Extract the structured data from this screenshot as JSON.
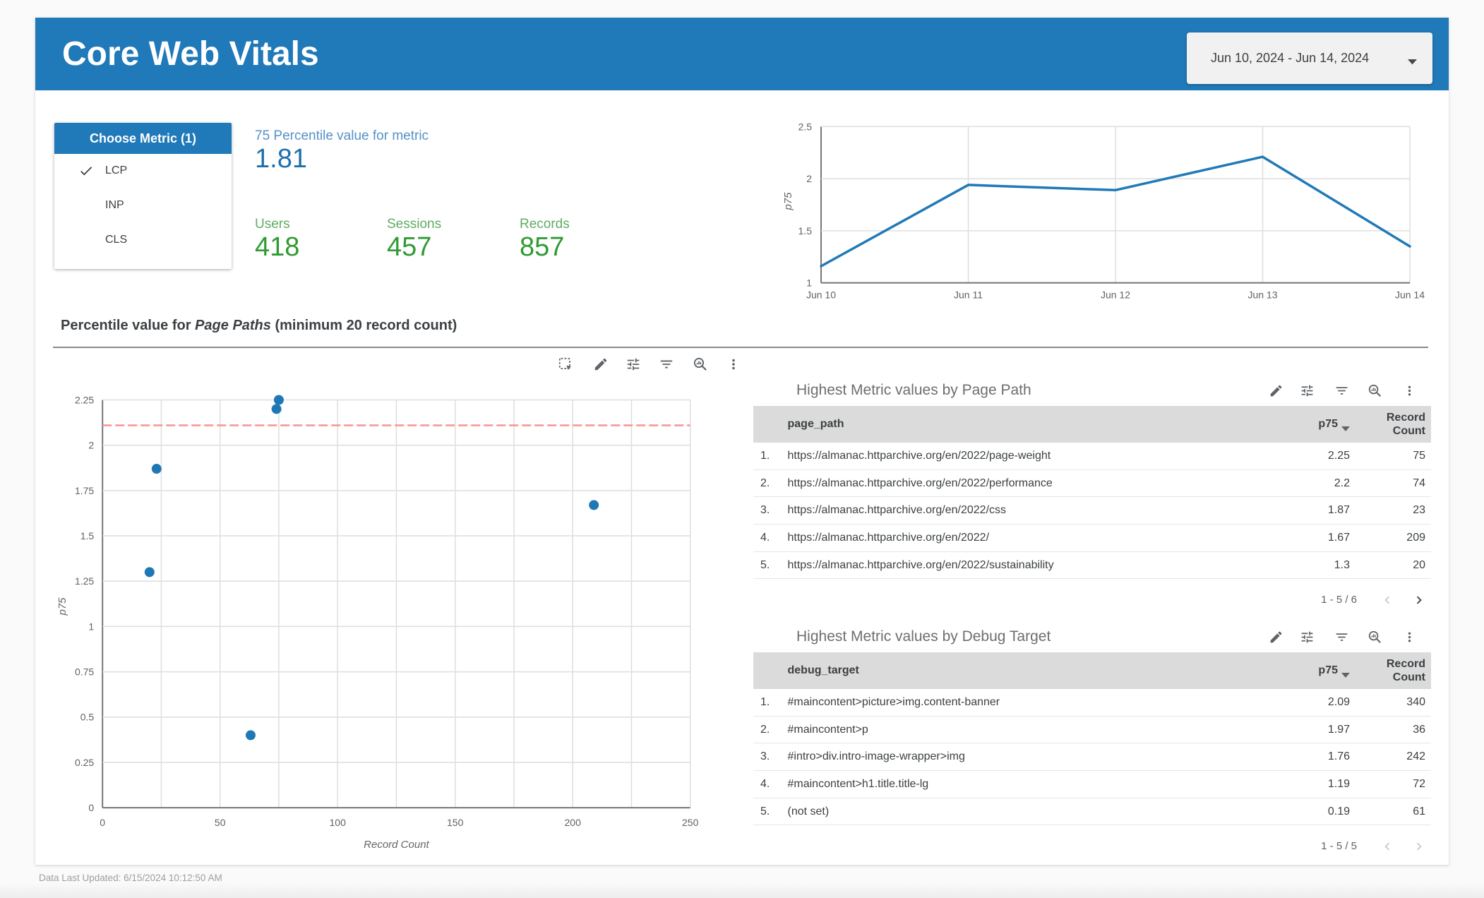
{
  "header": {
    "title": "Core Web Vitals",
    "date_range": "Jun 10, 2024 - Jun 14, 2024"
  },
  "metric_selector": {
    "title": "Choose Metric (1)",
    "options": [
      {
        "label": "LCP",
        "selected": true
      },
      {
        "label": "INP",
        "selected": false
      },
      {
        "label": "CLS",
        "selected": false
      }
    ]
  },
  "scorecards": [
    {
      "id": "percentile",
      "label": "75 Percentile value for metric",
      "value": "1.81",
      "label_color": "#5591c8",
      "value_color": "#1d6fad"
    },
    {
      "id": "users",
      "label": "Users",
      "value": "418",
      "label_color": "#5fac63",
      "value_color": "#2f9b33"
    },
    {
      "id": "sessions",
      "label": "Sessions",
      "value": "457",
      "label_color": "#5fac63",
      "value_color": "#2f9b33"
    },
    {
      "id": "records",
      "label": "Records",
      "value": "857",
      "label_color": "#5fac63",
      "value_color": "#2f9b33"
    }
  ],
  "section": {
    "prefix": "Percentile value for ",
    "italic": "Page Paths",
    "suffix": " (minimum 20 record count)"
  },
  "scatter_toolbar_icons": [
    "marquee-select",
    "edit",
    "tune",
    "filter",
    "zoom-area",
    "more-vert"
  ],
  "table_toolbar_icons": [
    "edit",
    "tune",
    "filter",
    "zoom-area",
    "more-vert"
  ],
  "chart_data": [
    {
      "type": "line",
      "title": "",
      "x": [
        "Jun 10",
        "Jun 11",
        "Jun 12",
        "Jun 13",
        "Jun 14"
      ],
      "series": [
        {
          "name": "p75",
          "values": [
            1.16,
            1.94,
            1.89,
            2.21,
            1.35
          ]
        }
      ],
      "ylabel": "p75",
      "xlabel": "",
      "ylim": [
        1,
        2.5
      ],
      "yticks": [
        1,
        1.5,
        2,
        2.5
      ],
      "grid": true,
      "line_color": "#2079b8"
    },
    {
      "type": "scatter",
      "title": "",
      "points": [
        {
          "x": 75,
          "y": 2.25
        },
        {
          "x": 74,
          "y": 2.2
        },
        {
          "x": 23,
          "y": 1.87
        },
        {
          "x": 209,
          "y": 1.67
        },
        {
          "x": 20,
          "y": 1.3
        },
        {
          "x": 63,
          "y": 0.4
        }
      ],
      "xlabel": "Record Count",
      "ylabel": "p75",
      "xlim": [
        0,
        250
      ],
      "ylim": [
        0,
        2.25
      ],
      "xtick_step": 25,
      "xlabel_every": 2,
      "ytick_step": 0.25,
      "grid": true,
      "point_color": "#1f78b5",
      "threshold": {
        "value": 2.11,
        "color": "#f59492",
        "style": "dashed"
      }
    }
  ],
  "tables": [
    {
      "title": "Highest Metric values by Page Path",
      "columns": [
        "page_path",
        "p75",
        "Record Count"
      ],
      "sort_column": "p75",
      "rows": [
        {
          "index": "1.",
          "dimension": "https://almanac.httparchive.org/en/2022/page-weight",
          "p75": "2.25",
          "count": "75"
        },
        {
          "index": "2.",
          "dimension": "https://almanac.httparchive.org/en/2022/performance",
          "p75": "2.2",
          "count": "74"
        },
        {
          "index": "3.",
          "dimension": "https://almanac.httparchive.org/en/2022/css",
          "p75": "1.87",
          "count": "23"
        },
        {
          "index": "4.",
          "dimension": "https://almanac.httparchive.org/en/2022/",
          "p75": "1.67",
          "count": "209"
        },
        {
          "index": "5.",
          "dimension": "https://almanac.httparchive.org/en/2022/sustainability",
          "p75": "1.3",
          "count": "20"
        }
      ],
      "pagination": {
        "label": "1 - 5 / 6",
        "prev_enabled": false,
        "next_enabled": true
      }
    },
    {
      "title": "Highest Metric values by Debug Target",
      "columns": [
        "debug_target",
        "p75",
        "Record Count"
      ],
      "sort_column": "p75",
      "rows": [
        {
          "index": "1.",
          "dimension": "#maincontent>picture>img.content-banner",
          "p75": "2.09",
          "count": "340"
        },
        {
          "index": "2.",
          "dimension": "#maincontent>p",
          "p75": "1.97",
          "count": "36"
        },
        {
          "index": "3.",
          "dimension": "#intro>div.intro-image-wrapper>img",
          "p75": "1.76",
          "count": "242"
        },
        {
          "index": "4.",
          "dimension": "#maincontent>h1.title.title-lg",
          "p75": "1.19",
          "count": "72"
        },
        {
          "index": "5.",
          "dimension": "(not set)",
          "p75": "0.19",
          "count": "61"
        }
      ],
      "pagination": {
        "label": "1 - 5 / 5",
        "prev_enabled": false,
        "next_enabled": false
      }
    }
  ],
  "footer": {
    "last_updated": "Data Last Updated: 6/15/2024 10:12:50 AM"
  },
  "colors": {
    "header_blue": "#2079b8",
    "chart_blue": "#1f78b5",
    "value_blue": "#1d6fad",
    "label_blue": "#5591c8",
    "value_green": "#2f9b33",
    "label_green": "#5fac63",
    "threshold_red": "#f59492",
    "table_header_bg": "#dbdbdb",
    "grid_gray": "#dedede",
    "axis_gray": "#757575"
  }
}
